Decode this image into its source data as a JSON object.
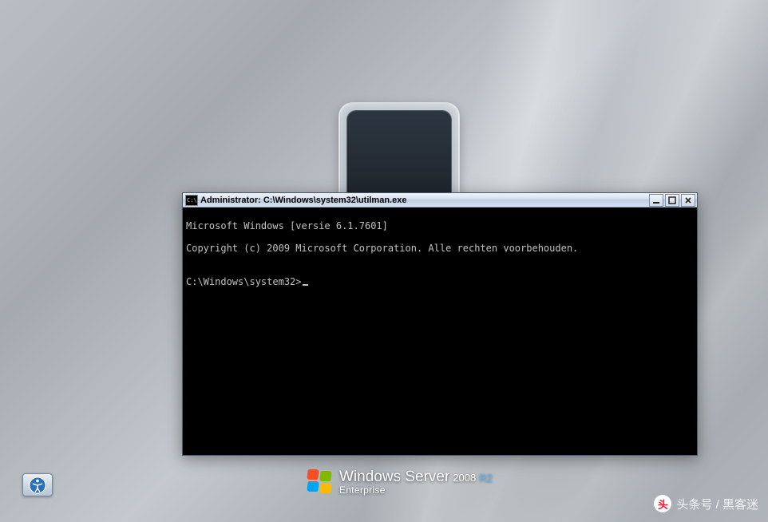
{
  "cmd_window": {
    "title": "Administrator: C:\\Windows\\system32\\utilman.exe",
    "icon_text": "C:\\",
    "lines": {
      "l1": "Microsoft Windows [versie 6.1.7601]",
      "l2": "Copyright (c) 2009 Microsoft Corporation. Alle rechten voorbehouden.",
      "l3": "",
      "l4": "C:\\Windows\\system32>"
    },
    "controls": {
      "minimize": "minimize",
      "maximize": "maximize",
      "close": "close"
    }
  },
  "branding": {
    "product": "Windows Server",
    "year": "2008",
    "suffix": "R2",
    "edition": "Enterprise"
  },
  "ease_of_access": {
    "label": "Ease of access"
  },
  "watermark": {
    "text": "头条号 / 黑客迷",
    "logo_char": "头"
  }
}
